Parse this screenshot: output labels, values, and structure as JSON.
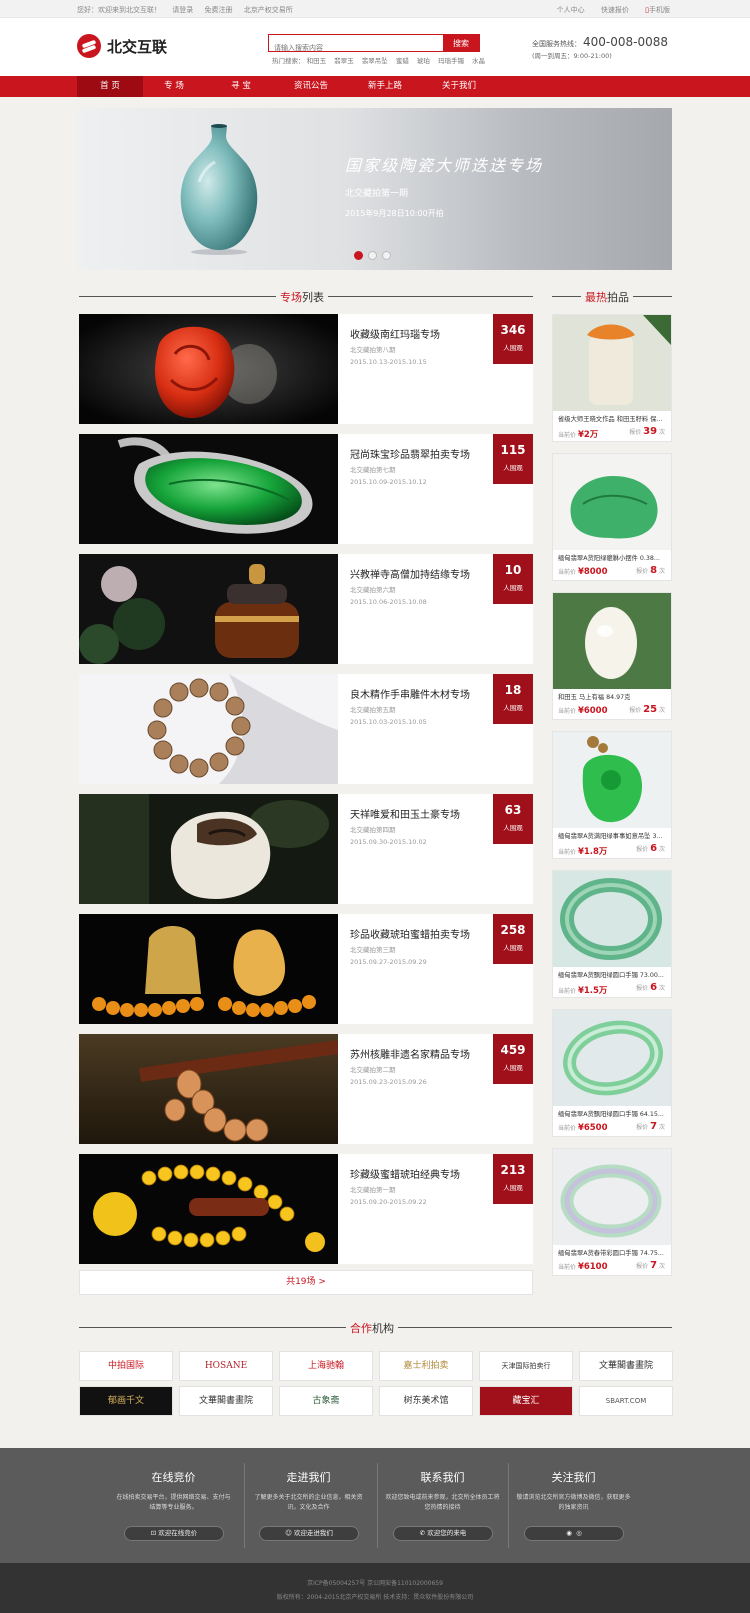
{
  "topbar": {
    "welcome": "您好：欢迎来到北交互联！",
    "login": "请登录",
    "register": "免费注册",
    "exchange": "北京产权交易所",
    "user_center": "个人中心",
    "quick_quote": "快速报价",
    "mobile": "手机版"
  },
  "header": {
    "logo_text": "北交互联",
    "search_placeholder": "请输入搜索内容",
    "search_button": "搜索",
    "hot_label": "热门搜索：",
    "hot_words": [
      "和田玉",
      "翡翠玉",
      "翡翠吊坠",
      "蜜蜡",
      "琥珀",
      "玛瑙手镯",
      "水晶"
    ],
    "hotline_label": "全国服务热线：",
    "hotline_number": "400-008-0088",
    "hours": "(周一到周五：9:00-21:00)"
  },
  "nav": [
    "首 页",
    "专 场",
    "寻 宝",
    "资讯公告",
    "新手上路",
    "关于我们"
  ],
  "banner": {
    "title": "国家级陶瓷大师迭送专场",
    "subtitle": "北交藏拍第一期",
    "date": "2015年9月28日10:00开拍"
  },
  "section_special": {
    "title_a": "专场",
    "title_b": "列表"
  },
  "section_hot": {
    "title_a": "最热",
    "title_b": "拍品"
  },
  "specials": [
    {
      "name": "收藏级南红玛瑙专场",
      "sub": "北交藏拍第八期",
      "date": "2015.10.13-2015.10.15",
      "count": "346",
      "unit": "人围观"
    },
    {
      "name": "冠尚珠宝珍品翡翠拍卖专场",
      "sub": "北交藏拍第七期",
      "date": "2015.10.09-2015.10.12",
      "count": "115",
      "unit": "人围观"
    },
    {
      "name": "兴教禅寺高僧加持结缘专场",
      "sub": "北交藏拍第六期",
      "date": "2015.10.06-2015.10.08",
      "count": "10",
      "unit": "人围观"
    },
    {
      "name": "良木精作手串雕件木材专场",
      "sub": "北交藏拍第五期",
      "date": "2015.10.03-2015.10.05",
      "count": "18",
      "unit": "人围观"
    },
    {
      "name": "天祥唯爱和田玉土豪专场",
      "sub": "北交藏拍第四期",
      "date": "2015.09.30-2015.10.02",
      "count": "63",
      "unit": "人围观"
    },
    {
      "name": "珍品收藏琥珀蜜蜡拍卖专场",
      "sub": "北交藏拍第三期",
      "date": "2015.09.27-2015.09.29",
      "count": "258",
      "unit": "人围观"
    },
    {
      "name": "苏州核雕非遗名家精品专场",
      "sub": "北交藏拍第二期",
      "date": "2015.09.23-2015.09.26",
      "count": "459",
      "unit": "人围观"
    },
    {
      "name": "珍藏级蜜蜡琥珀经典专场",
      "sub": "北交藏拍第一期",
      "date": "2015.09.20-2015.09.22",
      "count": "213",
      "unit": "人围观"
    }
  ],
  "more_label": "共19场 >",
  "hot_items": [
    {
      "name": "省级大师王晓文作品 和田玉籽料 保...",
      "price_label": "当前价",
      "price": "¥2万",
      "bid_label": "报价",
      "bids": "39",
      "bid_unit": "次"
    },
    {
      "name": "缅甸翡翠A货阳绿貔貅小摆件 0.38...",
      "price_label": "当前价",
      "price": "¥8000",
      "bid_label": "报价",
      "bids": "8",
      "bid_unit": "次"
    },
    {
      "name": "和田玉 马上有福 84.97克",
      "price_label": "当前价",
      "price": "¥6000",
      "bid_label": "报价",
      "bids": "25",
      "bid_unit": "次"
    },
    {
      "name": "缅甸翡翠A货满阳绿事事如意吊坠 3...",
      "price_label": "当前价",
      "price": "¥1.8万",
      "bid_label": "报价",
      "bids": "6",
      "bid_unit": "次"
    },
    {
      "name": "缅甸翡翠A货飘阳绿圆口手镯 73.00...",
      "price_label": "当前价",
      "price": "¥1.5万",
      "bid_label": "报价",
      "bids": "6",
      "bid_unit": "次"
    },
    {
      "name": "缅甸翡翠A货飘阳绿圆口手镯 64.15...",
      "price_label": "当前价",
      "price": "¥6500",
      "bid_label": "报价",
      "bids": "7",
      "bid_unit": "次"
    },
    {
      "name": "缅甸翡翠A货春带彩圆口手镯 74.75...",
      "price_label": "当前价",
      "price": "¥6100",
      "bid_label": "报价",
      "bids": "7",
      "bid_unit": "次"
    }
  ],
  "section_partner": {
    "title_a": "合作",
    "title_b": "机构"
  },
  "partners": [
    {
      "name": "中拍国际",
      "color": "#c9151e"
    },
    {
      "name": "HOSANE",
      "color": "#b3262d"
    },
    {
      "name": "上海驰翰",
      "color": "#c9151e"
    },
    {
      "name": "嘉士利拍卖",
      "color": "#b28a3b"
    },
    {
      "name": "天津国际拍卖行",
      "color": "#333333"
    },
    {
      "name": "文華閣書畫院",
      "color": "#333333"
    },
    {
      "name": "郁画千文",
      "color": "#d8b25a"
    },
    {
      "name": "文華閣書畫院",
      "color": "#333333"
    },
    {
      "name": "古象斋",
      "color": "#2f5d3a"
    },
    {
      "name": "树东美术馆",
      "color": "#333333"
    },
    {
      "name": "藏宝汇",
      "color": "#ffffff"
    },
    {
      "name": "SBART.COM",
      "color": "#555555"
    }
  ],
  "footer": [
    {
      "title": "在线竞价",
      "desc": "在线拍卖交易平台，提供网络交易、支付与结算等专业服务。",
      "btn": "欢迎在线竞价"
    },
    {
      "title": "走进我们",
      "desc": "了解更多关于北交所的企业信息，相关资讯，文化及合作",
      "btn": "欢迎走进我们"
    },
    {
      "title": "联系我们",
      "desc": "欢迎您致电或前来参观，北交所全体员工将您热情的接待",
      "btn": "欢迎您的来电"
    },
    {
      "title": "关注我们",
      "desc": "敬请浏览北交所官方微博及微信，获取更多的独家资讯",
      "btn": ""
    }
  ],
  "copyright": {
    "line1": "京ICP备05004257号    京公网安备110102000659",
    "line2": "版权所有：2004-2015北京产权交易所    技术支持：贯众软件股份有限公司"
  }
}
